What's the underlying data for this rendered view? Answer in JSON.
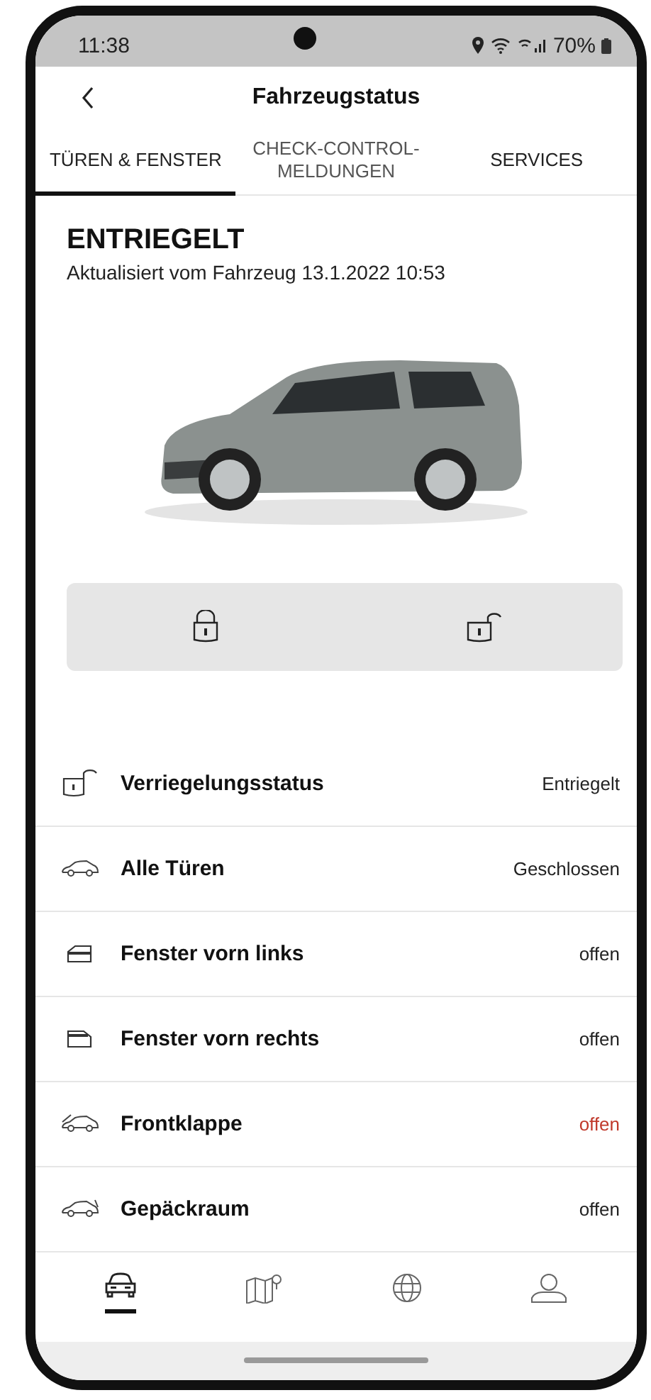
{
  "status_bar": {
    "time": "11:38",
    "battery": "70%"
  },
  "header": {
    "title": "Fahrzeugstatus"
  },
  "tabs": [
    {
      "label": "TÜREN & FENSTER",
      "selected": true
    },
    {
      "label": "CHECK-CONTROL-\nMELDUNGEN",
      "selected": false
    },
    {
      "label": "SERVICES",
      "selected": false
    }
  ],
  "status": {
    "heading": "ENTRIEGELT",
    "updated": "Aktualisiert vom Fahrzeug 13.1.2022 10:53"
  },
  "lock_actions": [
    {
      "kind": "lock"
    },
    {
      "kind": "unlock"
    }
  ],
  "rows": [
    {
      "kind": "padlock",
      "label": "Verriegelungsstatus",
      "value": "Entriegelt",
      "warning": false
    },
    {
      "kind": "doors",
      "label": "Alle Türen",
      "value": "Geschlossen",
      "warning": false
    },
    {
      "kind": "window_left",
      "label": "Fenster vorn links",
      "value": "offen",
      "warning": false
    },
    {
      "kind": "window_right",
      "label": "Fenster vorn rechts",
      "value": "offen",
      "warning": false
    },
    {
      "kind": "hood",
      "label": "Frontklappe",
      "value": "offen",
      "warning": true
    },
    {
      "kind": "trunk",
      "label": "Gepäckraum",
      "value": "offen",
      "warning": false
    }
  ],
  "bottom_nav": [
    {
      "kind": "car",
      "selected": true
    },
    {
      "kind": "map",
      "selected": false
    },
    {
      "kind": "globe",
      "selected": false
    },
    {
      "kind": "profile",
      "selected": false
    }
  ]
}
